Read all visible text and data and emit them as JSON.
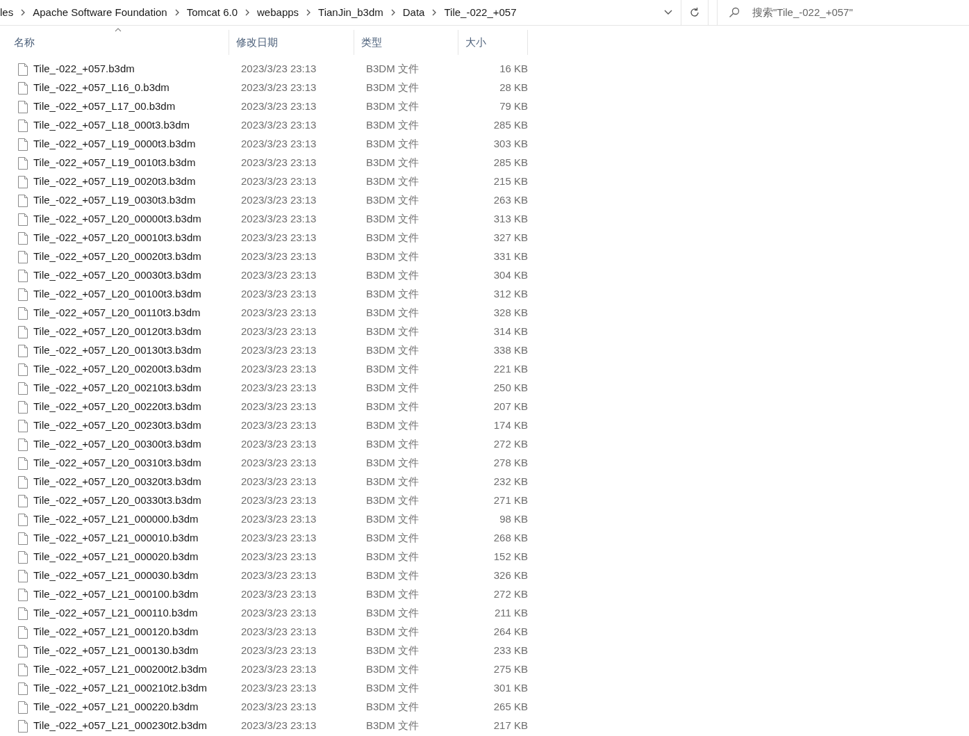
{
  "breadcrumb": [
    "les",
    "Apache Software Foundation",
    "Tomcat 6.0",
    "webapps",
    "TianJin_b3dm",
    "Data",
    "Tile_-022_+057"
  ],
  "search": {
    "placeholder": "搜索\"Tile_-022_+057\""
  },
  "columns": [
    {
      "label": "名称",
      "sorted": true
    },
    {
      "label": "修改日期",
      "sorted": false
    },
    {
      "label": "类型",
      "sorted": false
    },
    {
      "label": "大小",
      "sorted": false
    }
  ],
  "files": [
    {
      "name": "Tile_-022_+057.b3dm",
      "date": "2023/3/23 23:13",
      "type": "B3DM 文件",
      "size": "16 KB"
    },
    {
      "name": "Tile_-022_+057_L16_0.b3dm",
      "date": "2023/3/23 23:13",
      "type": "B3DM 文件",
      "size": "28 KB"
    },
    {
      "name": "Tile_-022_+057_L17_00.b3dm",
      "date": "2023/3/23 23:13",
      "type": "B3DM 文件",
      "size": "79 KB"
    },
    {
      "name": "Tile_-022_+057_L18_000t3.b3dm",
      "date": "2023/3/23 23:13",
      "type": "B3DM 文件",
      "size": "285 KB"
    },
    {
      "name": "Tile_-022_+057_L19_0000t3.b3dm",
      "date": "2023/3/23 23:13",
      "type": "B3DM 文件",
      "size": "303 KB"
    },
    {
      "name": "Tile_-022_+057_L19_0010t3.b3dm",
      "date": "2023/3/23 23:13",
      "type": "B3DM 文件",
      "size": "285 KB"
    },
    {
      "name": "Tile_-022_+057_L19_0020t3.b3dm",
      "date": "2023/3/23 23:13",
      "type": "B3DM 文件",
      "size": "215 KB"
    },
    {
      "name": "Tile_-022_+057_L19_0030t3.b3dm",
      "date": "2023/3/23 23:13",
      "type": "B3DM 文件",
      "size": "263 KB"
    },
    {
      "name": "Tile_-022_+057_L20_00000t3.b3dm",
      "date": "2023/3/23 23:13",
      "type": "B3DM 文件",
      "size": "313 KB"
    },
    {
      "name": "Tile_-022_+057_L20_00010t3.b3dm",
      "date": "2023/3/23 23:13",
      "type": "B3DM 文件",
      "size": "327 KB"
    },
    {
      "name": "Tile_-022_+057_L20_00020t3.b3dm",
      "date": "2023/3/23 23:13",
      "type": "B3DM 文件",
      "size": "331 KB"
    },
    {
      "name": "Tile_-022_+057_L20_00030t3.b3dm",
      "date": "2023/3/23 23:13",
      "type": "B3DM 文件",
      "size": "304 KB"
    },
    {
      "name": "Tile_-022_+057_L20_00100t3.b3dm",
      "date": "2023/3/23 23:13",
      "type": "B3DM 文件",
      "size": "312 KB"
    },
    {
      "name": "Tile_-022_+057_L20_00110t3.b3dm",
      "date": "2023/3/23 23:13",
      "type": "B3DM 文件",
      "size": "328 KB"
    },
    {
      "name": "Tile_-022_+057_L20_00120t3.b3dm",
      "date": "2023/3/23 23:13",
      "type": "B3DM 文件",
      "size": "314 KB"
    },
    {
      "name": "Tile_-022_+057_L20_00130t3.b3dm",
      "date": "2023/3/23 23:13",
      "type": "B3DM 文件",
      "size": "338 KB"
    },
    {
      "name": "Tile_-022_+057_L20_00200t3.b3dm",
      "date": "2023/3/23 23:13",
      "type": "B3DM 文件",
      "size": "221 KB"
    },
    {
      "name": "Tile_-022_+057_L20_00210t3.b3dm",
      "date": "2023/3/23 23:13",
      "type": "B3DM 文件",
      "size": "250 KB"
    },
    {
      "name": "Tile_-022_+057_L20_00220t3.b3dm",
      "date": "2023/3/23 23:13",
      "type": "B3DM 文件",
      "size": "207 KB"
    },
    {
      "name": "Tile_-022_+057_L20_00230t3.b3dm",
      "date": "2023/3/23 23:13",
      "type": "B3DM 文件",
      "size": "174 KB"
    },
    {
      "name": "Tile_-022_+057_L20_00300t3.b3dm",
      "date": "2023/3/23 23:13",
      "type": "B3DM 文件",
      "size": "272 KB"
    },
    {
      "name": "Tile_-022_+057_L20_00310t3.b3dm",
      "date": "2023/3/23 23:13",
      "type": "B3DM 文件",
      "size": "278 KB"
    },
    {
      "name": "Tile_-022_+057_L20_00320t3.b3dm",
      "date": "2023/3/23 23:13",
      "type": "B3DM 文件",
      "size": "232 KB"
    },
    {
      "name": "Tile_-022_+057_L20_00330t3.b3dm",
      "date": "2023/3/23 23:13",
      "type": "B3DM 文件",
      "size": "271 KB"
    },
    {
      "name": "Tile_-022_+057_L21_000000.b3dm",
      "date": "2023/3/23 23:13",
      "type": "B3DM 文件",
      "size": "98 KB"
    },
    {
      "name": "Tile_-022_+057_L21_000010.b3dm",
      "date": "2023/3/23 23:13",
      "type": "B3DM 文件",
      "size": "268 KB"
    },
    {
      "name": "Tile_-022_+057_L21_000020.b3dm",
      "date": "2023/3/23 23:13",
      "type": "B3DM 文件",
      "size": "152 KB"
    },
    {
      "name": "Tile_-022_+057_L21_000030.b3dm",
      "date": "2023/3/23 23:13",
      "type": "B3DM 文件",
      "size": "326 KB"
    },
    {
      "name": "Tile_-022_+057_L21_000100.b3dm",
      "date": "2023/3/23 23:13",
      "type": "B3DM 文件",
      "size": "272 KB"
    },
    {
      "name": "Tile_-022_+057_L21_000110.b3dm",
      "date": "2023/3/23 23:13",
      "type": "B3DM 文件",
      "size": "211 KB"
    },
    {
      "name": "Tile_-022_+057_L21_000120.b3dm",
      "date": "2023/3/23 23:13",
      "type": "B3DM 文件",
      "size": "264 KB"
    },
    {
      "name": "Tile_-022_+057_L21_000130.b3dm",
      "date": "2023/3/23 23:13",
      "type": "B3DM 文件",
      "size": "233 KB"
    },
    {
      "name": "Tile_-022_+057_L21_000200t2.b3dm",
      "date": "2023/3/23 23:13",
      "type": "B3DM 文件",
      "size": "275 KB"
    },
    {
      "name": "Tile_-022_+057_L21_000210t2.b3dm",
      "date": "2023/3/23 23:13",
      "type": "B3DM 文件",
      "size": "301 KB"
    },
    {
      "name": "Tile_-022_+057_L21_000220.b3dm",
      "date": "2023/3/23 23:13",
      "type": "B3DM 文件",
      "size": "265 KB"
    },
    {
      "name": "Tile_-022_+057_L21_000230t2.b3dm",
      "date": "2023/3/23 23:13",
      "type": "B3DM 文件",
      "size": "217 KB"
    }
  ]
}
